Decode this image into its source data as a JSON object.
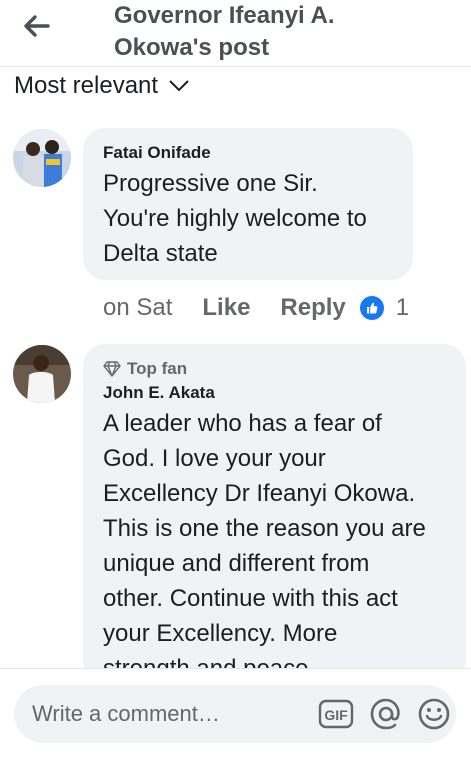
{
  "header": {
    "title_line1": "Governor Ifeanyi A.",
    "title_line2": "Okowa's post"
  },
  "sort": {
    "label": "Most relevant"
  },
  "comments": [
    {
      "author": "Fatai Onifade",
      "lines": [
        "Progressive one Sir.",
        "You're highly welcome to",
        "Delta state"
      ],
      "time": "on Sat",
      "like_label": "Like",
      "reply_label": "Reply",
      "reaction_count": "1"
    },
    {
      "badge": "Top fan",
      "author": "John E. Akata",
      "lines": [
        "A leader who has a fear of",
        "God. I love your your",
        "Excellency Dr Ifeanyi Okowa.",
        "This is one the reason you are",
        "unique and different from",
        "other. Continue with this act",
        "your Excellency. More",
        "strength and peace."
      ]
    }
  ],
  "composer": {
    "placeholder": "Write a comment…"
  },
  "icons": {
    "back": "arrow-left-icon",
    "sort": "chevron-down-icon",
    "like": "thumbs-up-icon",
    "badge": "diamond-icon",
    "gif": "gif-icon",
    "mention": "at-icon",
    "emoji": "smiley-icon"
  },
  "colors": {
    "like_blue": "#1877f2",
    "bubble": "#f0f2f5",
    "secondary_text": "#65676b"
  }
}
